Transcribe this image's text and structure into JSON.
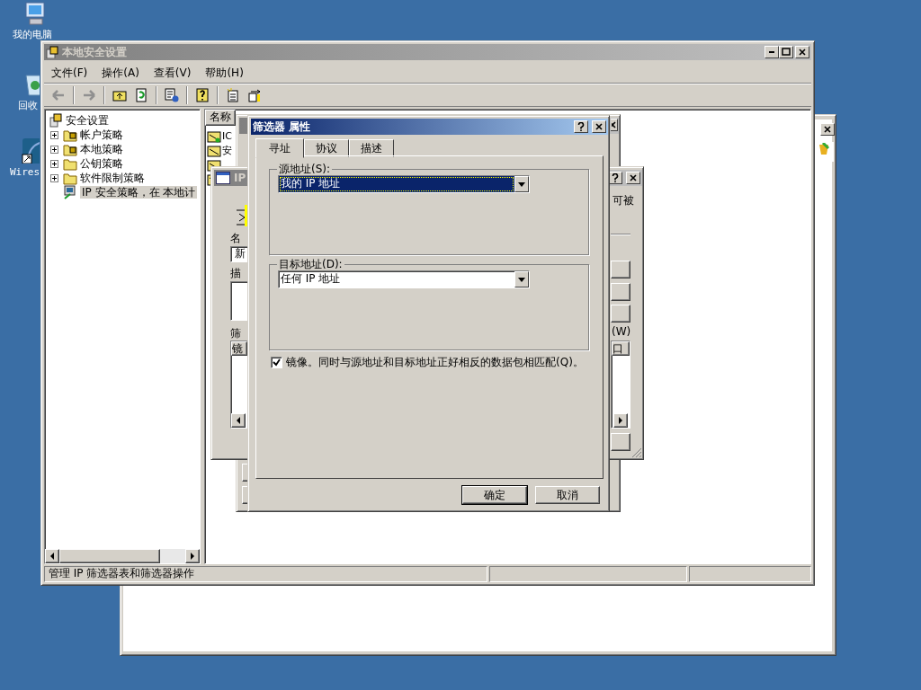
{
  "desktop_icons": [
    {
      "label": "我的电脑",
      "kind": "computer"
    },
    {
      "label": "回收",
      "kind": "recycle"
    },
    {
      "label": "Wires",
      "kind": "shortcut"
    }
  ],
  "main_window": {
    "title": "本地安全设置",
    "menu": [
      "文件(F)",
      "操作(A)",
      "查看(V)",
      "帮助(H)"
    ],
    "tree": {
      "label": "安全设置",
      "children": [
        {
          "label": "帐户策略",
          "kind": "lock-folder",
          "expandable": true,
          "selected": false
        },
        {
          "label": "本地策略",
          "kind": "lock-folder",
          "expandable": true,
          "selected": false
        },
        {
          "label": "公钥策略",
          "kind": "folder",
          "expandable": true,
          "selected": false
        },
        {
          "label": "软件限制策略",
          "kind": "folder",
          "expandable": true,
          "selected": false
        },
        {
          "label": "IP 安全策略，在 本地计",
          "kind": "computer",
          "expandable": false,
          "selected": true
        }
      ]
    },
    "list_header": "名称",
    "list_items": [
      {
        "label": "IC",
        "kind": "filter-list"
      },
      {
        "label": "安",
        "kind": "filter-list"
      },
      {
        "kind": "filter-list"
      },
      {
        "kind": "filter-list"
      }
    ],
    "status_bar": "管理 IP 筛选器表和筛选器操作"
  },
  "ip_dialog": {
    "title": "IP",
    "name_label": "名",
    "name_value": "新",
    "desc_label": "描",
    "filters_label": "筛",
    "list_header": "镜",
    "right_text": "可被",
    "right_label": "(W)",
    "right_header": "口"
  },
  "filter_dialog": {
    "title": "筛选器 属性",
    "tabs": [
      {
        "label": "寻址",
        "selected": true
      },
      {
        "label": "协议",
        "selected": false
      },
      {
        "label": "描述",
        "selected": false
      }
    ],
    "source": {
      "label": "源地址(S):",
      "value": "我的 IP 地址",
      "focused": true
    },
    "destination": {
      "label": "目标地址(D):",
      "value": "任何 IP 地址",
      "focused": false
    },
    "mirror": {
      "label": "镜像。同时与源地址和目标地址正好相反的数据包相匹配(Q)。",
      "checked": true
    },
    "buttons": [
      {
        "label": "确定",
        "default": true
      },
      {
        "label": "取消",
        "default": false
      }
    ]
  }
}
